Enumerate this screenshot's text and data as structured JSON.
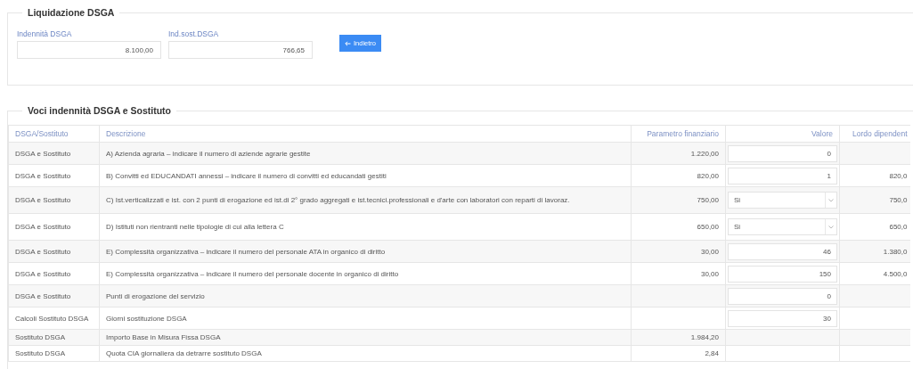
{
  "liquidazione": {
    "legend": "Liquidazione DSGA",
    "fields": [
      {
        "label": "Indennità DSGA",
        "value": "8.100,00"
      },
      {
        "label": "Ind.sost.DSGA",
        "value": "766,65"
      }
    ],
    "back_button": {
      "label": "Indietro"
    }
  },
  "voci": {
    "legend": "Voci indennità DSGA e Sostituto",
    "columns": [
      "DSGA/Sostituto",
      "Descrizione",
      "Parametro finanziario",
      "Valore",
      "Lordo dipendent"
    ],
    "rows": [
      {
        "tipo": "DSGA e Sostituto",
        "descrizione": "A) Azienda agraria – indicare il numero di aziende agrarie gestite",
        "parametro": "1.220,00",
        "valore": {
          "kind": "input",
          "value": "0"
        }
      },
      {
        "tipo": "DSGA e Sostituto",
        "descrizione": "B) Convitti ed EDUCANDATI annessi – indicare il numero di convitti ed educandati gestiti",
        "parametro": "820,00",
        "valore": {
          "kind": "input",
          "value": "1"
        },
        "lordo": "820,0"
      },
      {
        "tipo": "DSGA e Sostituto",
        "descrizione": "C) Ist.verticalizzati e ist. con 2 punti di erogazione ed ist.di 2° grado aggregati e ist.tecnici.professionali e d'arte con laboratori con reparti di lavoraz.",
        "parametro": "750,00",
        "valore": {
          "kind": "select",
          "value": "Si"
        },
        "lordo": "750,0"
      },
      {
        "tipo": "DSGA e Sostituto",
        "descrizione": "D) Istituti non rientranti nelle tipologie di cui alla lettera C",
        "parametro": "650,00",
        "valore": {
          "kind": "select",
          "value": "Si"
        },
        "lordo": "650,0"
      },
      {
        "tipo": "DSGA e Sostituto",
        "descrizione": "E) Complessità organizzativa – indicare il numero del personale ATA in organico di diritto",
        "parametro": "30,00",
        "valore": {
          "kind": "input",
          "value": "46"
        },
        "lordo": "1.380,0"
      },
      {
        "tipo": "DSGA e Sostituto",
        "descrizione": "E) Complessità organizzativa – indicare il numero del personale docente in organico di diritto",
        "parametro": "30,00",
        "valore": {
          "kind": "input",
          "value": "150"
        },
        "lordo": "4.500,0"
      },
      {
        "tipo": "DSGA e Sostituto",
        "descrizione": "Punti di erogazione del servizio",
        "valore": {
          "kind": "input",
          "value": "0"
        }
      },
      {
        "tipo": "Calcoli Sostituto DSGA",
        "descrizione": "Giorni sostituzione DSGA",
        "valore": {
          "kind": "input",
          "value": "30"
        }
      },
      {
        "tipo": "Sostituto DSGA",
        "descrizione": "Importo Base in Misura Fissa DSGA",
        "parametro": "1.984,20"
      },
      {
        "tipo": "Sostituto DSGA",
        "descrizione": "Quota CIA giornaliera da detrarre sostituto DSGA",
        "parametro": "2,84"
      }
    ]
  }
}
